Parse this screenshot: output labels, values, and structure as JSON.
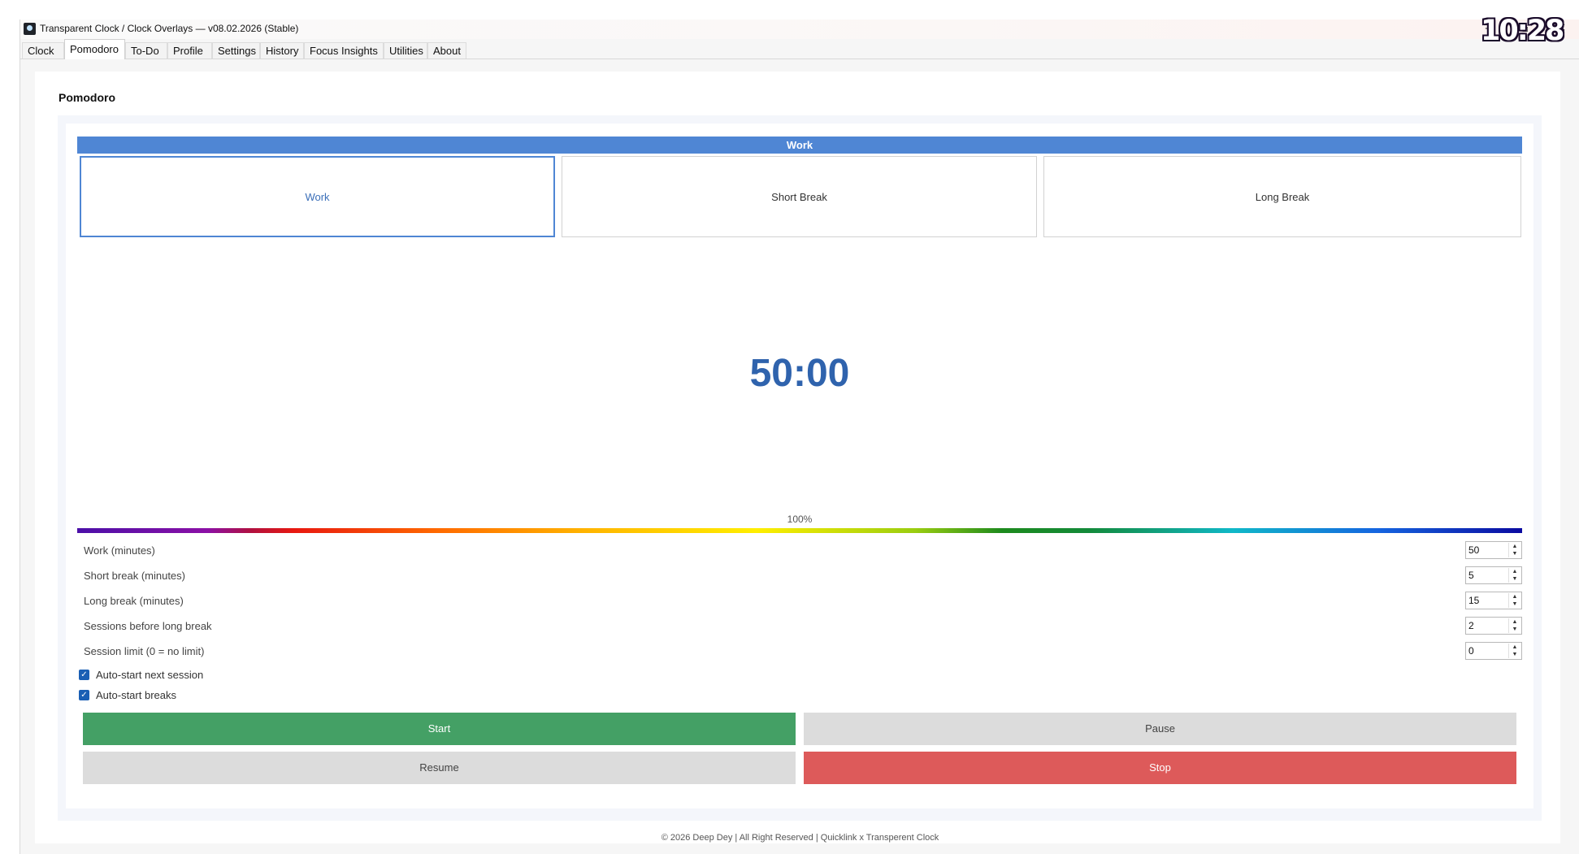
{
  "window": {
    "title": "Transparent Clock / Clock Overlays — v08.02.2026 (Stable)",
    "controls": {
      "minimize": "–",
      "restore": "⧉",
      "close": "✕"
    }
  },
  "tabs": [
    {
      "label": "Clock"
    },
    {
      "label": "Pomodoro",
      "active": true
    },
    {
      "label": "To-Do"
    },
    {
      "label": "Profile"
    },
    {
      "label": "Settings"
    },
    {
      "label": "History"
    },
    {
      "label": "Focus Insights"
    },
    {
      "label": "Utilities"
    },
    {
      "label": "About"
    }
  ],
  "overlay_clock": "10:28",
  "page": {
    "title": "Pomodoro",
    "mode_header": "Work",
    "modes": [
      {
        "label": "Work",
        "active": true
      },
      {
        "label": "Short Break"
      },
      {
        "label": "Long Break"
      }
    ],
    "timer": "50:00",
    "progress_text": "100%",
    "progress_fraction": 1.0,
    "settings": [
      {
        "label": "Work (minutes)",
        "value": "50"
      },
      {
        "label": "Short break (minutes)",
        "value": "5"
      },
      {
        "label": "Long break (minutes)",
        "value": "15"
      },
      {
        "label": "Sessions before long break",
        "value": "2"
      },
      {
        "label": "Session limit (0 = no limit)",
        "value": "0"
      }
    ],
    "checks": [
      {
        "label": "Auto-start next session",
        "checked": true
      },
      {
        "label": "Auto-start breaks",
        "checked": true
      }
    ],
    "buttons": {
      "start": "Start",
      "pause": "Pause",
      "resume": "Resume",
      "stop": "Stop"
    }
  },
  "colors": {
    "accent": "#4f86d4",
    "timer": "#2f63ad",
    "start": "#44a065",
    "stop": "#dd5a5a",
    "neutral_button": "#dcdcdc"
  },
  "footer": "© 2026 Deep Dey | All Right Reserved | Quicklink x Transperent Clock"
}
